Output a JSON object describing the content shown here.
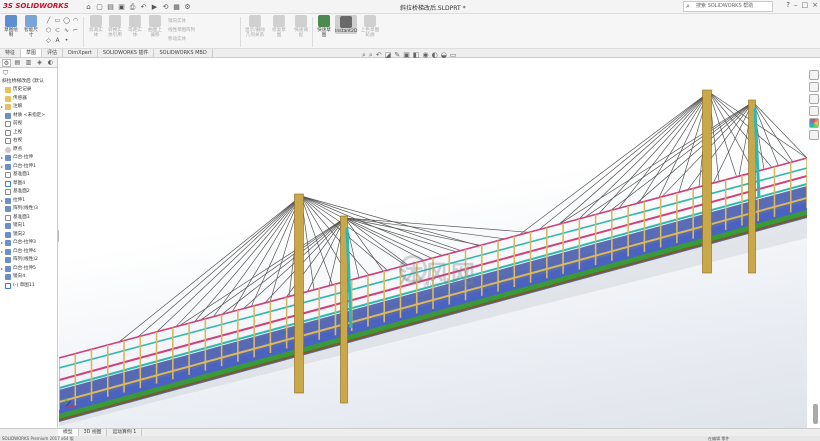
{
  "app": {
    "logo_ds": "3S",
    "logo_name": "SOLIDWORKS",
    "doc_title": "斜拉桥梯改后.SLDPRT *",
    "search_placeholder": "搜索 SOLIDWORKS 帮助",
    "window_controls": [
      "?",
      "–",
      "□",
      "×"
    ]
  },
  "ribbon": {
    "buttons": [
      {
        "label": "草图绘制",
        "enabled": true
      },
      {
        "label": "智能尺寸",
        "enabled": true
      },
      {
        "label": "剪裁实体",
        "enabled": false
      },
      {
        "label": "转换实体引用",
        "enabled": false
      },
      {
        "label": "等距实体",
        "enabled": false
      },
      {
        "label": "曲面上偏移",
        "enabled": false
      },
      {
        "label": "镜向实体",
        "enabled": false
      },
      {
        "label": "线性草图阵列",
        "enabled": false
      },
      {
        "label": "移动实体",
        "enabled": false
      },
      {
        "label": "显示/删除几何关系",
        "enabled": false
      },
      {
        "label": "修复草图",
        "enabled": false
      },
      {
        "label": "快速捕捉",
        "enabled": true
      },
      {
        "label": "快速草图",
        "enabled": true
      },
      {
        "label": "Instant2D",
        "enabled": true
      },
      {
        "label": "上色草图轮廓",
        "enabled": false
      }
    ],
    "list_items": [
      "镜向实体",
      "线性草图阵列",
      "移动实体"
    ]
  },
  "tabs": [
    "特征",
    "草图",
    "评估",
    "DimXpert",
    "SOLIDWORKS 插件",
    "SOLIDWORKS MBD"
  ],
  "active_tab": 1,
  "panel_tabs": [
    "feature-tree",
    "property",
    "config",
    "dim",
    "display"
  ],
  "tree": {
    "root": "斜拉桥梯改后 (默认",
    "items": [
      {
        "label": "历史记录",
        "icon": "fold",
        "expand": false
      },
      {
        "label": "传感器",
        "icon": "fold",
        "expand": false
      },
      {
        "label": "注解",
        "icon": "fold",
        "expand": true
      },
      {
        "label": "材质 <未指定>",
        "icon": "feat",
        "expand": false
      },
      {
        "label": "前视",
        "icon": "plane",
        "expand": false
      },
      {
        "label": "上视",
        "icon": "plane",
        "expand": false
      },
      {
        "label": "右视",
        "icon": "plane",
        "expand": false
      },
      {
        "label": "原点",
        "icon": "point",
        "expand": false
      },
      {
        "label": "凸台-拉伸",
        "icon": "feat",
        "expand": true
      },
      {
        "label": "凸台-拉伸1",
        "icon": "feat",
        "expand": true
      },
      {
        "label": "基准面1",
        "icon": "plane",
        "expand": false
      },
      {
        "label": "草图4",
        "icon": "sketch",
        "expand": false
      },
      {
        "label": "基准面2",
        "icon": "plane",
        "expand": false
      },
      {
        "label": "拉伸1",
        "icon": "feat",
        "expand": true
      },
      {
        "label": "阵列(线性)3",
        "icon": "feat",
        "expand": false
      },
      {
        "label": "基准面3",
        "icon": "plane",
        "expand": false
      },
      {
        "label": "镜向1",
        "icon": "feat",
        "expand": false
      },
      {
        "label": "镜向2",
        "icon": "feat",
        "expand": false
      },
      {
        "label": "凸台-拉伸3",
        "icon": "feat",
        "expand": true
      },
      {
        "label": "凸台-拉伸4",
        "icon": "feat",
        "expand": true
      },
      {
        "label": "阵列(线性)2",
        "icon": "feat",
        "expand": false
      },
      {
        "label": "凸台-拉伸5",
        "icon": "feat",
        "expand": true
      },
      {
        "label": "镜向4",
        "icon": "feat",
        "expand": false
      },
      {
        "label": "(-) 草图11",
        "icon": "sketch",
        "expand": false
      }
    ]
  },
  "watermark": {
    "text": "沐风网",
    "url": "www.mfcad.com"
  },
  "bottom_tabs": [
    "模型",
    "3D 视图",
    "运动算例 1"
  ],
  "status": {
    "left": "SOLIDWORKS Premium 2017 x64 版",
    "right": "在编辑 零件"
  },
  "colors": {
    "tower": "#c9a84a",
    "cable": "#555555",
    "rail_pink": "#d0407a",
    "rail_teal": "#30b8b0",
    "deck_blue": "#4a62c0",
    "deck_green": "#3a9a3a",
    "post": "#d8b860"
  }
}
